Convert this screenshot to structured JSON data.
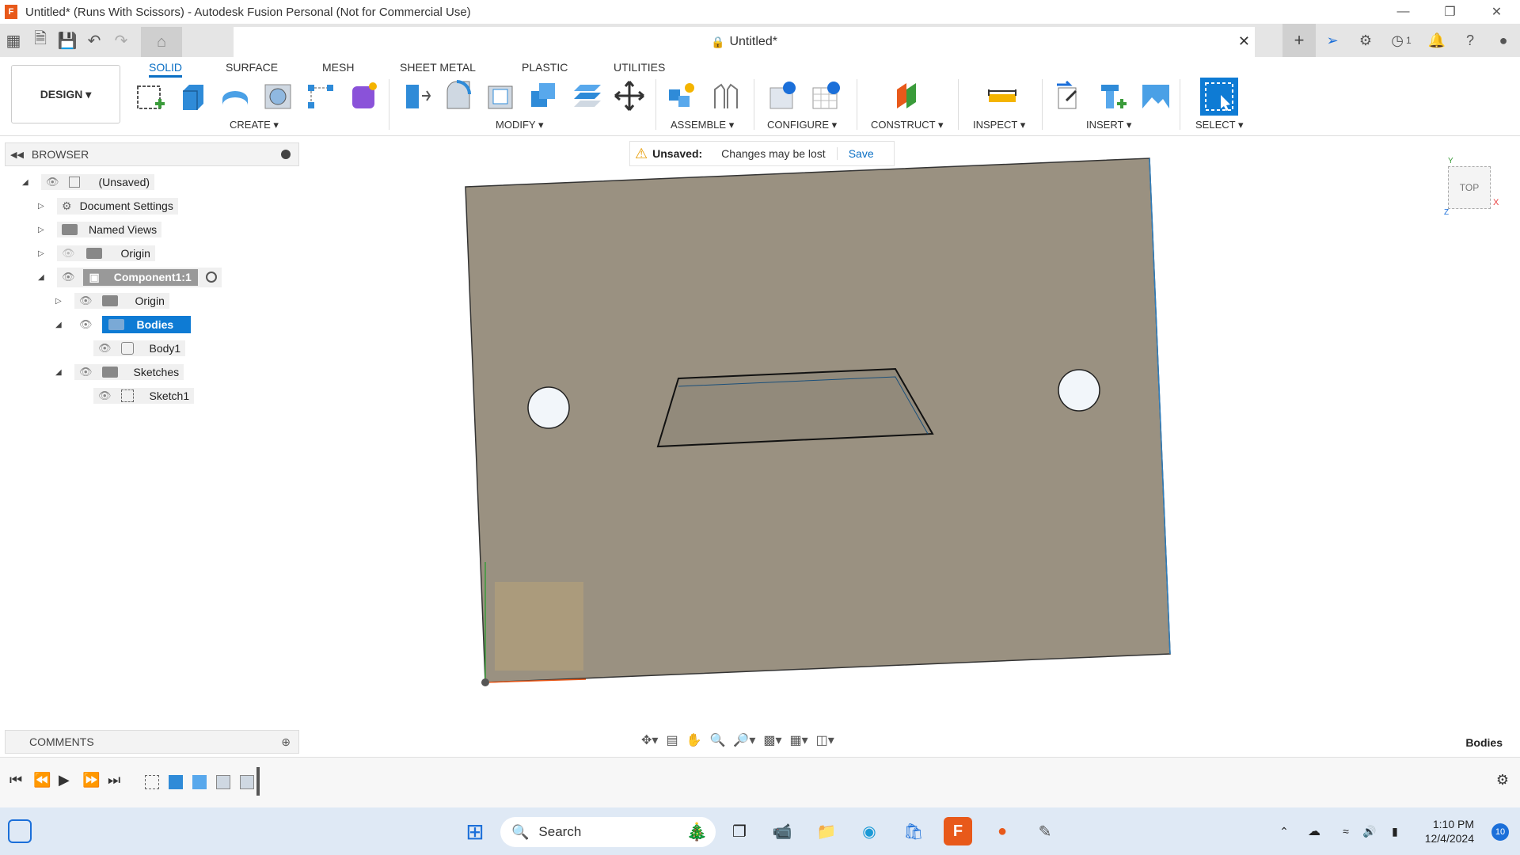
{
  "window": {
    "title": "Untitled* (Runs With Scissors) - Autodesk Fusion Personal (Not for Commercial Use)",
    "app_icon_letter": "F"
  },
  "tabbar": {
    "doc_tab_title": "Untitled*",
    "job_count": "1"
  },
  "ribbon": {
    "workspace": "DESIGN",
    "tabs": [
      "SOLID",
      "SURFACE",
      "MESH",
      "SHEET METAL",
      "PLASTIC",
      "UTILITIES"
    ],
    "groups": [
      "CREATE",
      "MODIFY",
      "ASSEMBLE",
      "CONFIGURE",
      "CONSTRUCT",
      "INSPECT",
      "INSERT",
      "SELECT"
    ]
  },
  "browser": {
    "label": "BROWSER",
    "items": [
      {
        "label": "(Unsaved)"
      },
      {
        "label": "Document Settings"
      },
      {
        "label": "Named Views"
      },
      {
        "label": "Origin"
      },
      {
        "label": "Component1:1"
      },
      {
        "label": "Origin"
      },
      {
        "label": "Bodies"
      },
      {
        "label": "Body1"
      },
      {
        "label": "Sketches"
      },
      {
        "label": "Sketch1"
      }
    ]
  },
  "unsaved_bar": {
    "title": "Unsaved:",
    "message": "Changes may be lost",
    "save": "Save"
  },
  "viewcube": {
    "face": "TOP",
    "x_axis": "X",
    "y_axis": "Y",
    "z_axis": "Z"
  },
  "comments": {
    "label": "COMMENTS"
  },
  "statusbar": {
    "selection": "Bodies"
  },
  "taskbar": {
    "search_placeholder": "Search",
    "time": "1:10 PM",
    "date": "12/4/2024",
    "notifications": "10"
  },
  "colors": {
    "accent": "#0a6fc4",
    "model_face": "#9a9181",
    "selected_bg": "#0e7bd4",
    "fusion_orange": "#e8591a"
  }
}
